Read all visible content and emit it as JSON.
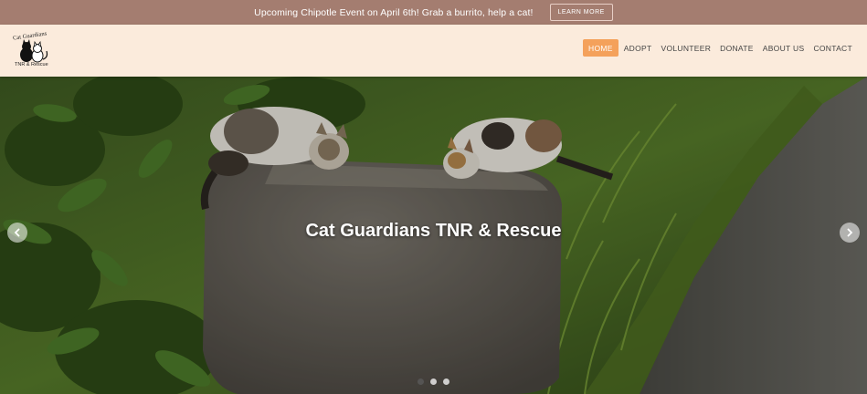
{
  "announcement": {
    "text": "Upcoming Chipotle Event on April 6th! Grab a burrito, help a cat!",
    "button_label": "LEARN MORE"
  },
  "logo": {
    "top_text": "Cat Guardians",
    "bottom_text": "TNR & Rescue"
  },
  "nav": {
    "items": [
      {
        "label": "HOME",
        "active": true
      },
      {
        "label": "ADOPT"
      },
      {
        "label": "VOLUNTEER"
      },
      {
        "label": "DONATE"
      },
      {
        "label": "ABOUT US"
      },
      {
        "label": "CONTACT"
      }
    ]
  },
  "hero": {
    "title": "Cat Guardians TNR & Rescue",
    "prev_icon": "chevron-left-icon",
    "next_icon": "chevron-right-icon",
    "slides_count": 3,
    "active_slide": 1
  },
  "colors": {
    "announce_bg": "#a47d70",
    "header_bg": "#fbebdc",
    "nav_active": "#f4a15b"
  }
}
